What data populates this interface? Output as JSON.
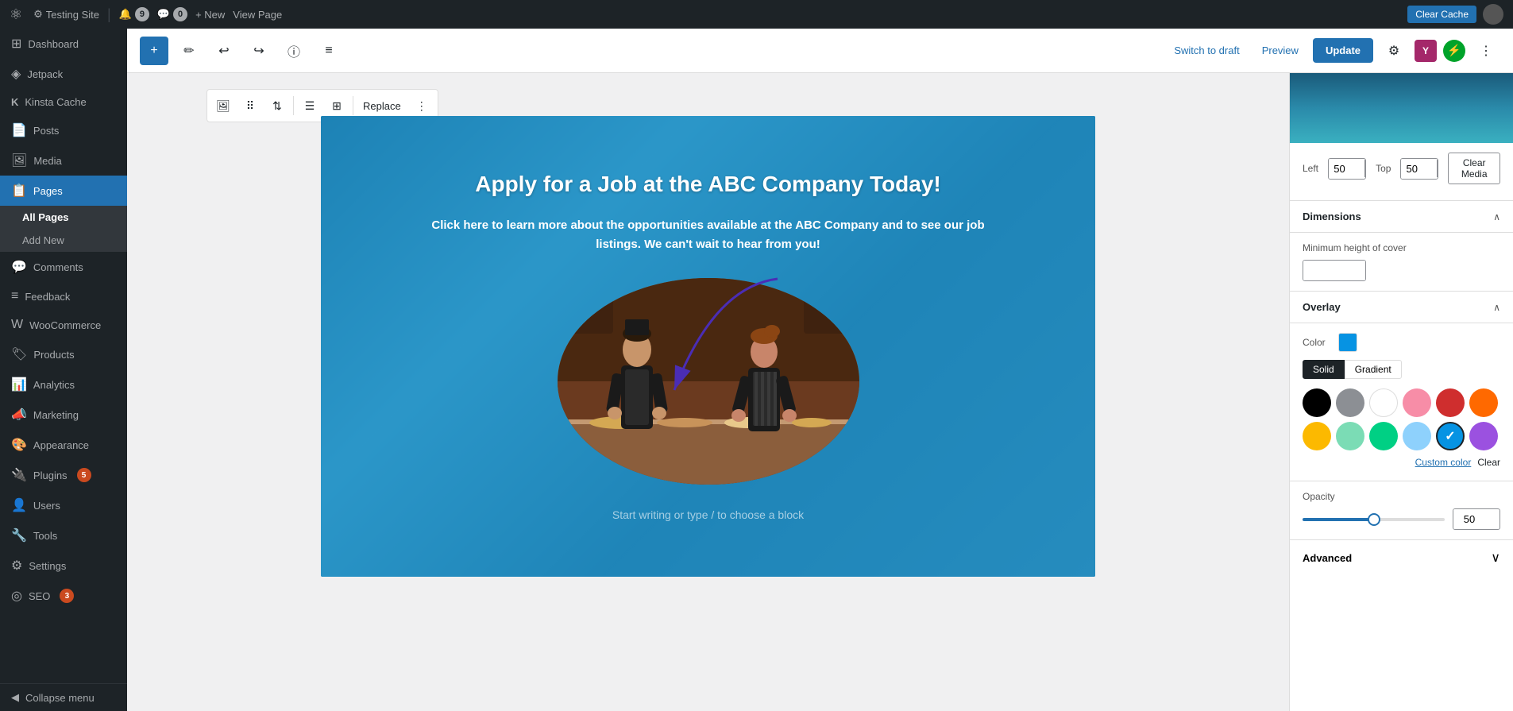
{
  "adminBar": {
    "siteIcon": "⚙",
    "siteName": "Testing Site",
    "updatesCount": "9",
    "commentsCount": "0",
    "newLabel": "+ New",
    "viewPageLabel": "View Page",
    "clearCacheLabel": "Clear Cache"
  },
  "sidebar": {
    "items": [
      {
        "id": "dashboard",
        "icon": "⊞",
        "label": "Dashboard"
      },
      {
        "id": "jetpack",
        "icon": "◈",
        "label": "Jetpack"
      },
      {
        "id": "kinsta-cache",
        "icon": "K",
        "label": "Kinsta Cache"
      },
      {
        "id": "posts",
        "icon": "📄",
        "label": "Posts"
      },
      {
        "id": "media",
        "icon": "🖼",
        "label": "Media"
      },
      {
        "id": "pages",
        "icon": "📋",
        "label": "Pages"
      }
    ],
    "pagesSubItems": [
      {
        "id": "all-pages",
        "label": "All Pages"
      },
      {
        "id": "add-new",
        "label": "Add New"
      }
    ],
    "bottomItems": [
      {
        "id": "comments",
        "icon": "💬",
        "label": "Comments"
      },
      {
        "id": "feedback",
        "icon": "≡",
        "label": "Feedback"
      },
      {
        "id": "woocommerce",
        "icon": "W",
        "label": "WooCommerce"
      },
      {
        "id": "products",
        "icon": "🏷",
        "label": "Products"
      },
      {
        "id": "analytics",
        "icon": "📊",
        "label": "Analytics"
      },
      {
        "id": "marketing",
        "icon": "📣",
        "label": "Marketing"
      },
      {
        "id": "appearance",
        "icon": "🎨",
        "label": "Appearance"
      },
      {
        "id": "plugins",
        "icon": "🔌",
        "label": "Plugins",
        "badge": "5"
      },
      {
        "id": "users",
        "icon": "👤",
        "label": "Users"
      },
      {
        "id": "tools",
        "icon": "🔧",
        "label": "Tools"
      },
      {
        "id": "settings",
        "icon": "⚙",
        "label": "Settings"
      },
      {
        "id": "seo",
        "icon": "◎",
        "label": "SEO",
        "badge": "3"
      }
    ],
    "collapseLabel": "Collapse menu"
  },
  "editorToolbar": {
    "addBlockIcon": "+",
    "editIcon": "✏",
    "undoIcon": "↩",
    "redoIcon": "↪",
    "infoIcon": "ⓘ",
    "listIcon": "≡",
    "switchToDraftLabel": "Switch to draft",
    "previewLabel": "Preview",
    "updateLabel": "Update",
    "settingsIcon": "⚙",
    "yoastLabel": "Y",
    "lightningLabel": "⚡",
    "moreIcon": "⋮"
  },
  "blockToolbar": {
    "imageIcon": "🖼",
    "dragIcon": "⠿",
    "arrowsIcon": "⇅",
    "alignIcon": "☰",
    "gridIcon": "⊞",
    "replaceLabel": "Replace",
    "moreIcon": "⋮"
  },
  "coverBlock": {
    "title": "Apply for a Job at the ABC Company Today!",
    "subtitle": "Click here to learn more about the opportunities available at the ABC Company and to see our job listings. We can't wait to hear from you!",
    "placeholder": "Start writing or type / to choose a block"
  },
  "rightPanel": {
    "positionSection": {
      "leftLabel": "Left",
      "leftValue": "50",
      "leftUnit": "%",
      "topLabel": "Top",
      "topValue": "50",
      "topUnit": "%",
      "clearMediaLabel": "Clear Media"
    },
    "dimensionsSection": {
      "title": "Dimensions",
      "minHeightLabel": "Minimum height of cover",
      "minHeightValue": "",
      "minHeightUnit": "%"
    },
    "overlaySection": {
      "title": "Overlay",
      "colorLabel": "Color",
      "solidLabel": "Solid",
      "gradientLabel": "Gradient",
      "customColorLabel": "Custom color",
      "clearLabel": "Clear"
    },
    "opacitySection": {
      "title": "Opacity",
      "value": "50"
    },
    "advancedSection": {
      "title": "Advanced"
    }
  }
}
